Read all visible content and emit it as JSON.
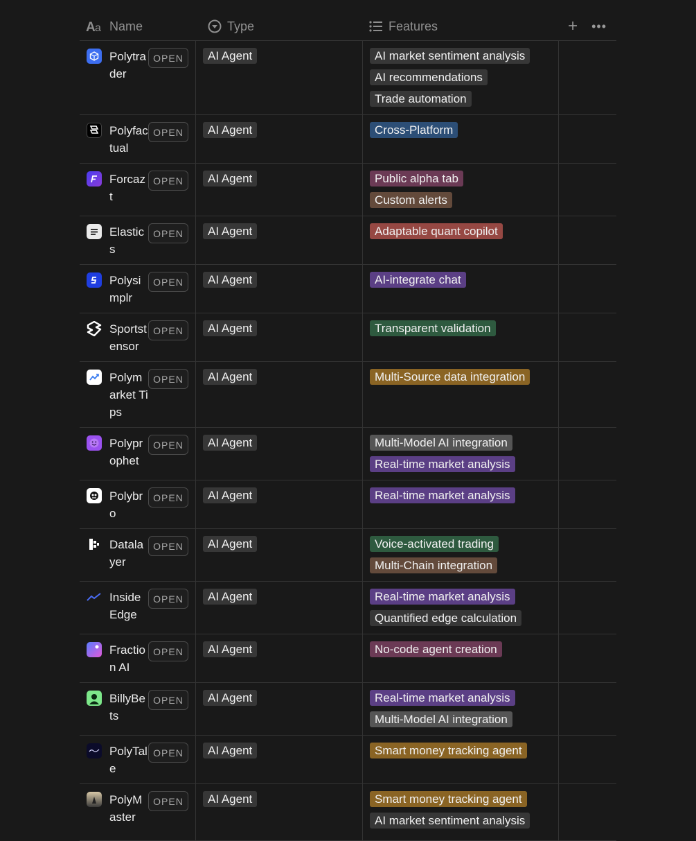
{
  "header": {
    "name_label": "Name",
    "type_label": "Type",
    "features_label": "Features",
    "add_label": "+",
    "more_label": "•••"
  },
  "open_label": "OPEN",
  "colors": {
    "default": "#373737",
    "blue": "#2c4e76",
    "pink": "#6b3a55",
    "brown": "#634a3b",
    "red": "#964843",
    "purple": "#5b3f85",
    "green": "#2e5a3f",
    "yellow": "#8a6424",
    "gray": "#555555"
  },
  "rows": [
    {
      "name": "Polytrader",
      "icon": "cube-icon",
      "type": "AI Agent",
      "features": [
        {
          "text": "AI market sentiment analysis",
          "color": "default"
        },
        {
          "text": "AI recommendations",
          "color": "default"
        },
        {
          "text": "Trade automation",
          "color": "default"
        }
      ]
    },
    {
      "name": "Polyfactual",
      "icon": "polyfactual-logo-icon",
      "type": "AI Agent",
      "features": [
        {
          "text": "Cross-Platform",
          "color": "blue"
        }
      ]
    },
    {
      "name": "Forcazt",
      "icon": "forcazt-logo-icon",
      "type": "AI Agent",
      "features": [
        {
          "text": "Public alpha tab",
          "color": "pink"
        },
        {
          "text": "Custom alerts",
          "color": "brown"
        }
      ]
    },
    {
      "name": "Elastics",
      "icon": "elastics-logo-icon",
      "type": "AI Agent",
      "features": [
        {
          "text": "Adaptable quant copilot",
          "color": "red"
        }
      ]
    },
    {
      "name": "Polysimplr",
      "icon": "polysimplr-logo-icon",
      "type": "AI Agent",
      "features": [
        {
          "text": "AI-integrate chat",
          "color": "purple"
        }
      ]
    },
    {
      "name": "Sportstensor",
      "icon": "sportstensor-logo-icon",
      "type": "AI Agent",
      "features": [
        {
          "text": "Transparent validation",
          "color": "green"
        }
      ]
    },
    {
      "name": "Polymarket Tips",
      "icon": "trend-chart-icon",
      "type": "AI Agent",
      "features": [
        {
          "text": "Multi-Source data integration",
          "color": "yellow"
        }
      ]
    },
    {
      "name": "Polyprophet",
      "icon": "smiling-face-icon",
      "type": "AI Agent",
      "features": [
        {
          "text": "Multi-Model AI integration",
          "color": "gray"
        },
        {
          "text": "Real-time market analysis",
          "color": "purple"
        }
      ]
    },
    {
      "name": "Polybro",
      "icon": "polybro-logo-icon",
      "type": "AI Agent",
      "features": [
        {
          "text": "Real-time market analysis",
          "color": "purple"
        }
      ]
    },
    {
      "name": "Datalayer",
      "icon": "datalayer-logo-icon",
      "type": "AI Agent",
      "features": [
        {
          "text": "Voice-activated trading",
          "color": "green"
        },
        {
          "text": "Multi-Chain integration",
          "color": "brown"
        }
      ]
    },
    {
      "name": "Inside Edge",
      "icon": "rising-line-icon",
      "type": "AI Agent",
      "features": [
        {
          "text": "Real-time market analysis",
          "color": "purple"
        },
        {
          "text": "Quantified edge calculation",
          "color": "default"
        }
      ]
    },
    {
      "name": "Fraction AI",
      "icon": "fraction-logo-icon",
      "type": "AI Agent",
      "features": [
        {
          "text": "No-code agent creation",
          "color": "pink"
        }
      ]
    },
    {
      "name": "BillyBets",
      "icon": "billybets-logo-icon",
      "type": "AI Agent",
      "features": [
        {
          "text": "Real-time market analysis",
          "color": "purple"
        },
        {
          "text": "Multi-Model AI integration",
          "color": "gray"
        }
      ]
    },
    {
      "name": "PolyTale",
      "icon": "polytale-logo-icon",
      "type": "AI Agent",
      "features": [
        {
          "text": "Smart money tracking agent",
          "color": "yellow"
        }
      ]
    },
    {
      "name": "PolyMaster",
      "icon": "polymaster-logo-icon",
      "type": "AI Agent",
      "features": [
        {
          "text": "Smart money tracking agent",
          "color": "yellow"
        },
        {
          "text": "AI market sentiment analysis",
          "color": "default"
        }
      ]
    }
  ]
}
